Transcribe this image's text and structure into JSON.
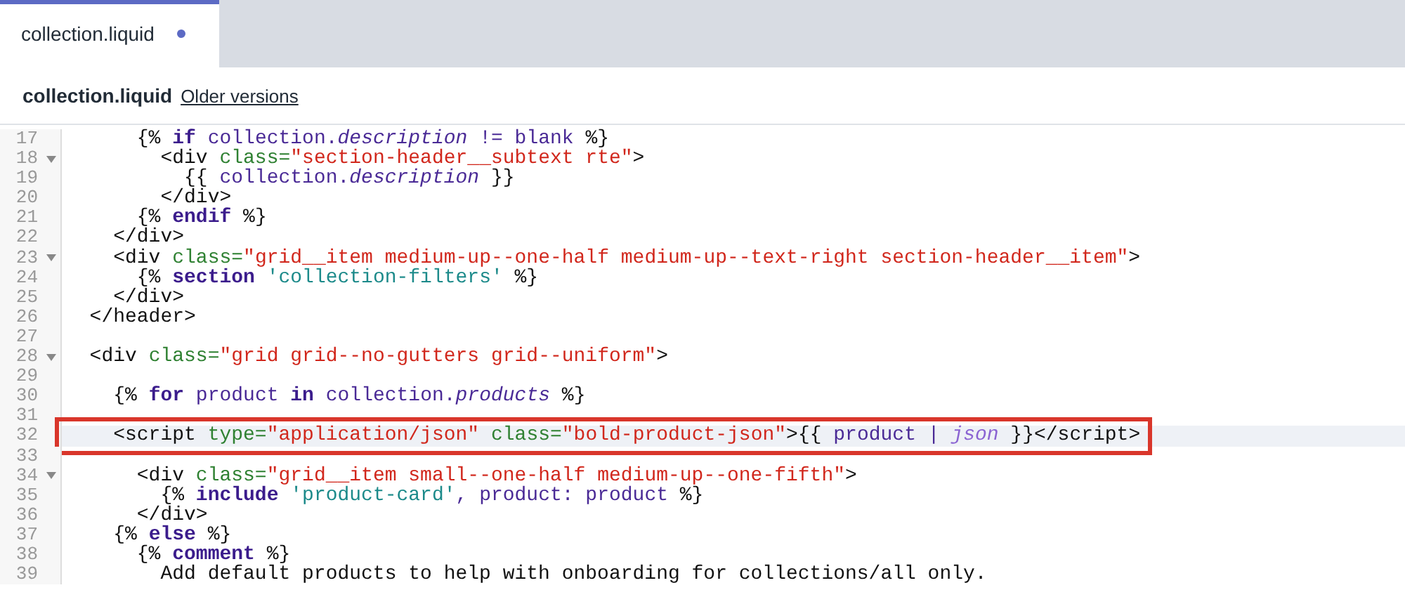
{
  "tabs": [
    {
      "label": "collection.liquid",
      "selected": true,
      "modified": true
    }
  ],
  "header": {
    "title": "collection.liquid",
    "link": "Older versions"
  },
  "editor": {
    "lines": [
      {
        "number": "17",
        "foldable": false,
        "active": false,
        "boxed": false,
        "tokens": [
          {
            "kind": "plain",
            "text": "      {% "
          },
          {
            "kind": "keyword",
            "text": "if"
          },
          {
            "kind": "variable",
            "text": " collection."
          },
          {
            "kind": "property",
            "text": "description"
          },
          {
            "kind": "variable",
            "text": " != blank "
          },
          {
            "kind": "plain",
            "text": "%}"
          }
        ]
      },
      {
        "number": "18",
        "foldable": true,
        "active": false,
        "boxed": false,
        "tokens": [
          {
            "kind": "plain",
            "text": "        <div "
          },
          {
            "kind": "attr",
            "text": "class="
          },
          {
            "kind": "string",
            "text": "\"section-header__subtext rte\""
          },
          {
            "kind": "plain",
            "text": ">"
          }
        ]
      },
      {
        "number": "19",
        "foldable": false,
        "active": false,
        "boxed": false,
        "tokens": [
          {
            "kind": "plain",
            "text": "          {{ "
          },
          {
            "kind": "variable",
            "text": "collection."
          },
          {
            "kind": "property",
            "text": "description"
          },
          {
            "kind": "plain",
            "text": " }}"
          }
        ]
      },
      {
        "number": "20",
        "foldable": false,
        "active": false,
        "boxed": false,
        "tokens": [
          {
            "kind": "plain",
            "text": "        </div>"
          }
        ]
      },
      {
        "number": "21",
        "foldable": false,
        "active": false,
        "boxed": false,
        "tokens": [
          {
            "kind": "plain",
            "text": "      {% "
          },
          {
            "kind": "keyword",
            "text": "endif"
          },
          {
            "kind": "plain",
            "text": " %}"
          }
        ]
      },
      {
        "number": "22",
        "foldable": false,
        "active": false,
        "boxed": false,
        "tokens": [
          {
            "kind": "plain",
            "text": "    </div>"
          }
        ]
      },
      {
        "number": "23",
        "foldable": true,
        "active": false,
        "boxed": false,
        "tokens": [
          {
            "kind": "plain",
            "text": "    <div "
          },
          {
            "kind": "attr",
            "text": "class="
          },
          {
            "kind": "string",
            "text": "\"grid__item medium-up--one-half medium-up--text-right section-header__item\""
          },
          {
            "kind": "plain",
            "text": ">"
          }
        ]
      },
      {
        "number": "24",
        "foldable": false,
        "active": false,
        "boxed": false,
        "tokens": [
          {
            "kind": "plain",
            "text": "      {% "
          },
          {
            "kind": "keyword",
            "text": "section "
          },
          {
            "kind": "liquid-string",
            "text": "'collection-filters'"
          },
          {
            "kind": "plain",
            "text": " %}"
          }
        ]
      },
      {
        "number": "25",
        "foldable": false,
        "active": false,
        "boxed": false,
        "tokens": [
          {
            "kind": "plain",
            "text": "    </div>"
          }
        ]
      },
      {
        "number": "26",
        "foldable": false,
        "active": false,
        "boxed": false,
        "tokens": [
          {
            "kind": "plain",
            "text": "  </header>"
          }
        ]
      },
      {
        "number": "27",
        "foldable": false,
        "active": false,
        "boxed": false
      },
      {
        "number": "28",
        "foldable": true,
        "active": false,
        "boxed": false,
        "tokens": [
          {
            "kind": "plain",
            "text": "  <div "
          },
          {
            "kind": "attr",
            "text": "class="
          },
          {
            "kind": "string",
            "text": "\"grid grid--no-gutters grid--uniform\""
          },
          {
            "kind": "plain",
            "text": ">"
          }
        ]
      },
      {
        "number": "29",
        "foldable": false,
        "active": false,
        "boxed": false
      },
      {
        "number": "30",
        "foldable": false,
        "active": false,
        "boxed": false,
        "tokens": [
          {
            "kind": "plain",
            "text": "    {% "
          },
          {
            "kind": "keyword",
            "text": "for"
          },
          {
            "kind": "variable",
            "text": " product "
          },
          {
            "kind": "keyword",
            "text": "in"
          },
          {
            "kind": "variable",
            "text": " collection."
          },
          {
            "kind": "property",
            "text": "products"
          },
          {
            "kind": "plain",
            "text": " %}"
          }
        ]
      },
      {
        "number": "31",
        "foldable": false,
        "active": false,
        "boxed": false
      },
      {
        "number": "32",
        "foldable": false,
        "active": true,
        "boxed": true,
        "tokens": [
          {
            "kind": "plain",
            "text": "    <script "
          },
          {
            "kind": "attr",
            "text": "type="
          },
          {
            "kind": "string",
            "text": "\"application/json\" "
          },
          {
            "kind": "attr",
            "text": "class="
          },
          {
            "kind": "string",
            "text": "\"bold-product-json\""
          },
          {
            "kind": "plain",
            "text": ">{{ "
          },
          {
            "kind": "variable",
            "text": "product | "
          },
          {
            "kind": "filter",
            "text": "json"
          },
          {
            "kind": "plain",
            "text": " }}</script>"
          }
        ]
      },
      {
        "number": "33",
        "foldable": false,
        "active": false,
        "boxed": false
      },
      {
        "number": "34",
        "foldable": true,
        "active": false,
        "boxed": false,
        "tokens": [
          {
            "kind": "plain",
            "text": "      <div "
          },
          {
            "kind": "attr",
            "text": "class="
          },
          {
            "kind": "string",
            "text": "\"grid__item small--one-half medium-up--one-fifth\""
          },
          {
            "kind": "plain",
            "text": ">"
          }
        ]
      },
      {
        "number": "35",
        "foldable": false,
        "active": false,
        "boxed": false,
        "tokens": [
          {
            "kind": "plain",
            "text": "        {% "
          },
          {
            "kind": "keyword",
            "text": "include "
          },
          {
            "kind": "liquid-string",
            "text": "'product-card'"
          },
          {
            "kind": "variable",
            "text": ", product: product "
          },
          {
            "kind": "plain",
            "text": "%}"
          }
        ]
      },
      {
        "number": "36",
        "foldable": false,
        "active": false,
        "boxed": false,
        "tokens": [
          {
            "kind": "plain",
            "text": "      </div>"
          }
        ]
      },
      {
        "number": "37",
        "foldable": false,
        "active": false,
        "boxed": false,
        "tokens": [
          {
            "kind": "plain",
            "text": "    {% "
          },
          {
            "kind": "keyword",
            "text": "else"
          },
          {
            "kind": "plain",
            "text": " %}"
          }
        ]
      },
      {
        "number": "38",
        "foldable": false,
        "active": false,
        "boxed": false,
        "tokens": [
          {
            "kind": "plain",
            "text": "      {% "
          },
          {
            "kind": "keyword",
            "text": "comment"
          },
          {
            "kind": "plain",
            "text": " %}"
          }
        ]
      },
      {
        "number": "39",
        "foldable": false,
        "active": false,
        "boxed": false,
        "tokens": [
          {
            "kind": "plain",
            "text": "        Add default products to help with onboarding for collections/all only."
          }
        ]
      }
    ]
  }
}
